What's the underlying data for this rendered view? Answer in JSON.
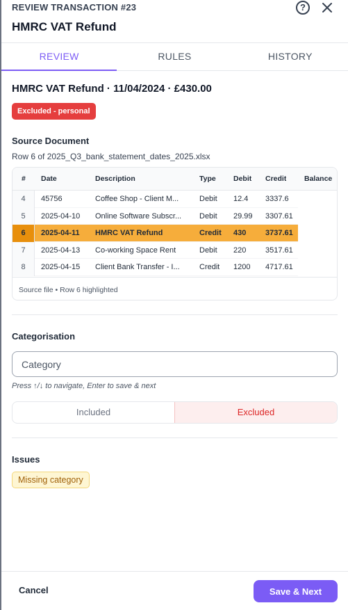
{
  "header": {
    "eyebrow": "REVIEW TRANSACTION #23",
    "title": "HMRC VAT Refund",
    "help_icon": "question-circle-icon",
    "close_icon": "close-icon"
  },
  "tabs": [
    {
      "label": "REVIEW",
      "active": true
    },
    {
      "label": "RULES",
      "active": false
    },
    {
      "label": "HISTORY",
      "active": false
    }
  ],
  "summary": {
    "line": "HMRC VAT Refund · 11/04/2024 · £430.00",
    "status_badge": "Excluded - personal",
    "status_color": "#e53e3e"
  },
  "source": {
    "heading": "Source Document",
    "file_line": "Row 6 of 2025_Q3_bank_statement_dates_2025.xlsx",
    "columns": [
      "#",
      "Date",
      "Description",
      "Type",
      "Debit",
      "Credit",
      "Balance"
    ],
    "rows": [
      {
        "num": "4",
        "date": "45756",
        "description": "Coffee Shop - Client M...",
        "type": "Debit",
        "debit": "12.4",
        "credit": "3337.6",
        "balance": "",
        "highlighted": false
      },
      {
        "num": "5",
        "date": "2025-04-10",
        "description": "Online Software Subscr...",
        "type": "Debit",
        "debit": "29.99",
        "credit": "3307.61",
        "balance": "",
        "highlighted": false
      },
      {
        "num": "6",
        "date": "2025-04-11",
        "description": "HMRC VAT Refund",
        "type": "Credit",
        "debit": "430",
        "credit": "3737.61",
        "balance": "",
        "highlighted": true
      },
      {
        "num": "7",
        "date": "2025-04-13",
        "description": "Co-working Space Rent",
        "type": "Debit",
        "debit": "220",
        "credit": "3517.61",
        "balance": "",
        "highlighted": false
      },
      {
        "num": "8",
        "date": "2025-04-15",
        "description": "Client Bank Transfer - I...",
        "type": "Credit",
        "debit": "1200",
        "credit": "4717.61",
        "balance": "",
        "highlighted": false
      }
    ],
    "footer_note": "Source file • Row 6 highlighted",
    "highlight_color": "#f6ad3b"
  },
  "categorisation": {
    "heading": "Categorisation",
    "category_placeholder": "Category",
    "category_value": "",
    "hint": "Press ↑/↓ to navigate, Enter to save & next",
    "included_label": "Included",
    "excluded_label": "Excluded",
    "selected": "Excluded"
  },
  "issues": {
    "heading": "Issues",
    "items": [
      "Missing category"
    ]
  },
  "footer": {
    "cancel_label": "Cancel",
    "save_label": "Save & Next",
    "accent_color": "#7b5cf5"
  }
}
